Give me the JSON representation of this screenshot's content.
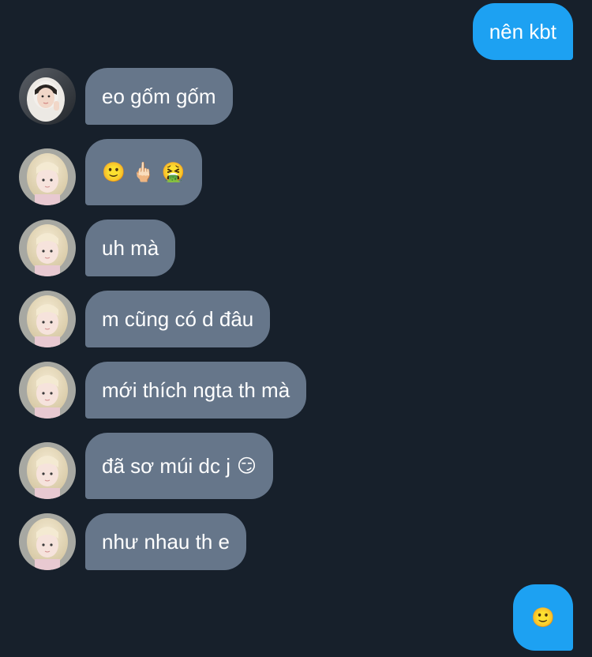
{
  "messages": [
    {
      "side": "out",
      "text": "nên kbt"
    },
    {
      "side": "in",
      "avatar": "avatar-hood",
      "text": "eo gốm gốm"
    },
    {
      "side": "in",
      "avatar": "avatar-blonde",
      "emojis": [
        "🙂",
        "🖕🏻",
        "🤮"
      ]
    },
    {
      "side": "in",
      "avatar": "avatar-blonde",
      "text": "uh mà"
    },
    {
      "side": "in",
      "avatar": "avatar-blonde",
      "text": "m cũng có d đâu"
    },
    {
      "side": "in",
      "avatar": "avatar-blonde",
      "text": "mới thích ngta th mà"
    },
    {
      "side": "in",
      "avatar": "avatar-blonde",
      "text": "đã sơ múi dc j",
      "trailing_emoji": "😏"
    },
    {
      "side": "in",
      "avatar": "avatar-blonde",
      "text": "như nhau th e"
    },
    {
      "side": "out",
      "emojis": [
        "🙂"
      ]
    }
  ],
  "colors": {
    "background": "#17202b",
    "incoming_bubble": "#66768a",
    "outgoing_bubble": "#1da1f2",
    "text": "#ffffff"
  }
}
